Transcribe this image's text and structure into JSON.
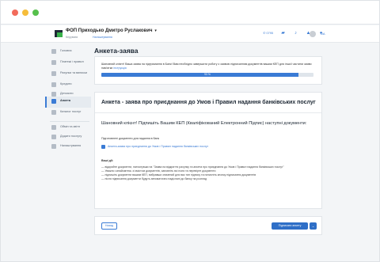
{
  "company": {
    "name": "ФОП Приходько Дмитро Руслакович",
    "sub_left": "Керувати",
    "sub_right": "Налаштування"
  },
  "topbar": {
    "phone": "0795"
  },
  "sidebar": {
    "items": [
      {
        "label": "Головна"
      },
      {
        "label": "Платежі і правил"
      },
      {
        "label": "Рахунки та виписки"
      },
      {
        "label": "Кредити"
      },
      {
        "label": "Депозити"
      },
      {
        "label": "Анкета"
      },
      {
        "label": "Каталог послуг"
      }
    ],
    "footer": [
      {
        "label": "Обмін та звітн"
      },
      {
        "label": "Додати послугу"
      },
      {
        "label": "Налаштування"
      }
    ]
  },
  "page": {
    "title": "Анкета-заява"
  },
  "notice": {
    "text": "Шановний клієнт! Ваша заява на підтримання в Банк! Вам необхідно завершити роботу з заявою підписанням документів вашим КЕП для іншої частини заяви пам'ятки",
    "link": "інструкція",
    "progress_label": "93 %",
    "progress_value": 0.93
  },
  "form": {
    "heading": "Анкета - заява про приєднання до Умов і Правил надання банківських послуг",
    "subheading": "Шановний клієнт! Підпишіть Вашим КЕП (Кваліфікований Електронний Підпис) наступні документи:",
    "docs_label": "Підготовлені документи для надання в банк",
    "doc_link": "Анкета-заява про приєднання до Умов і Правил надання банківських послуг",
    "steps_title": "Ваші дії:",
    "steps": [
      "— відкрийте документи, натиснувши на \"Заява на відкриття рахунку та анкета про приєднання до Умов і Правил надання банківських послуг\"",
      "— Уважно ознайомтесь зі змістом документів, заповніть всі поля та перевірте документи",
      "— підпишіть документи вашим КЕП, вибравши значений для вас тип підпису та натисніть кнопку підписання документів",
      "— після підписання документи будуть автоматично надіслані до банку на розгляд"
    ]
  },
  "actions": {
    "back": "Назад",
    "sign": "Підписати анкету",
    "more": "⌄"
  },
  "colors": {
    "accent": "#3a7bd5",
    "logo_green": "#38b04a",
    "logo_dark": "#1f2a36"
  },
  "icons": [
    "phone-icon",
    "chat-icon",
    "bell-icon",
    "graduation-cap-icon",
    "user-icon"
  ]
}
